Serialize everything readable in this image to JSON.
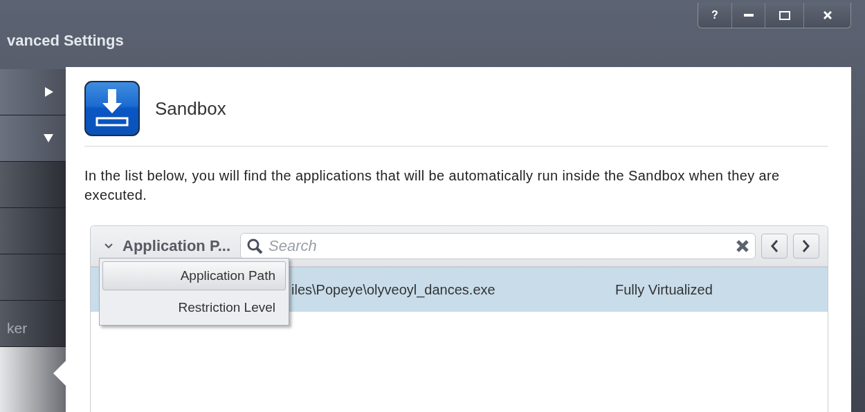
{
  "window": {
    "title": "vanced Settings",
    "help_button": "?"
  },
  "sidebar": {
    "items": [
      {
        "kind": "group",
        "expanded": false
      },
      {
        "kind": "group",
        "expanded": true
      },
      {
        "kind": "page"
      },
      {
        "kind": "page"
      },
      {
        "kind": "page"
      },
      {
        "kind": "page",
        "label": "ker"
      }
    ]
  },
  "section": {
    "title": "Sandbox",
    "description": "In the list below, you will find the applications that will be automatically run inside the Sandbox when they are executed."
  },
  "table": {
    "column_selector": "Application P...",
    "search": {
      "placeholder": "Search"
    },
    "column_menu": [
      {
        "label": "Application Path",
        "selected": true
      },
      {
        "label": "Restriction Level",
        "selected": false
      }
    ],
    "rows": [
      {
        "cells": [
          "iles\\Popeye\\olyveoyl_dances.exe",
          "Fully Virtualized"
        ],
        "selected": true
      }
    ]
  }
}
